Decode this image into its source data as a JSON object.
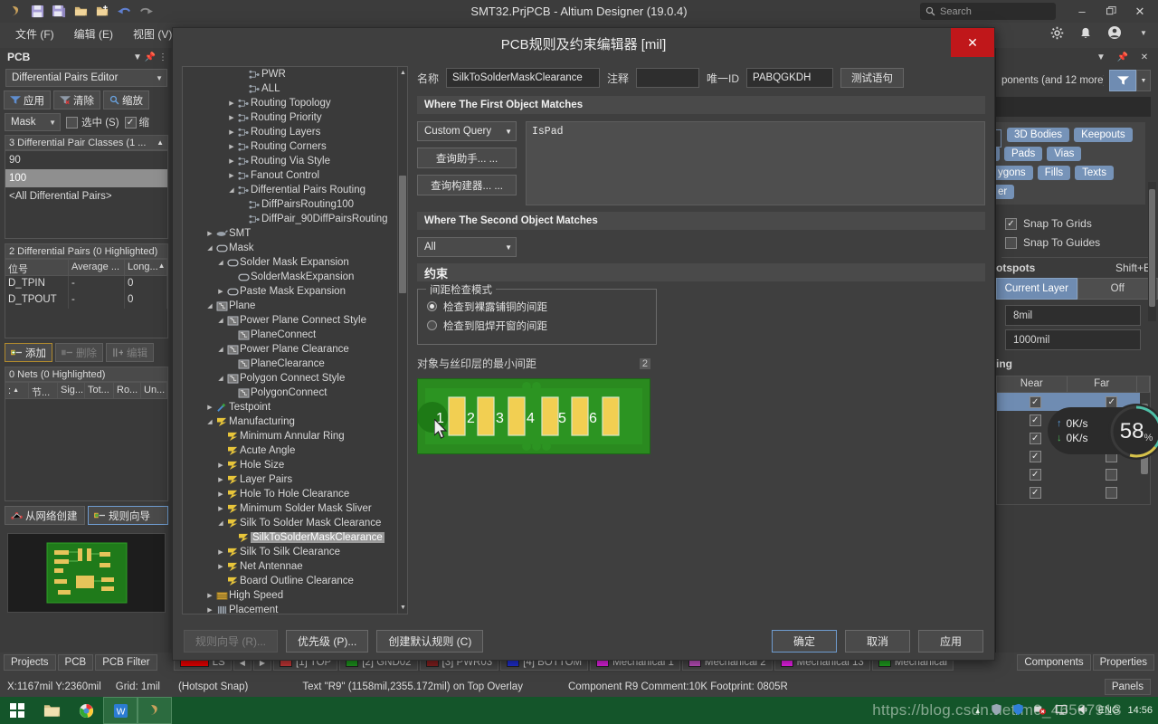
{
  "titlebar": {
    "title": "SMT32.PrjPCB - Altium Designer (19.0.4)",
    "search_placeholder": "Search",
    "minimize": "–",
    "maximize": "❐",
    "close": "✕"
  },
  "menubar": {
    "items": [
      {
        "label": "文件 (F)"
      },
      {
        "label": "编辑 (E)"
      },
      {
        "label": "视图 (V)"
      }
    ]
  },
  "left_panel": {
    "title": "PCB",
    "editor_select": "Differential Pairs Editor",
    "buttons": [
      {
        "label": "应用"
      },
      {
        "label": "清除"
      },
      {
        "label": "缩放"
      }
    ],
    "mask_select": "Mask",
    "select_checkbox_label": "选中 (S)",
    "zoom_checkbox_label": "缩",
    "classes_header": "3 Differential Pair Classes (1 ...",
    "classes": [
      {
        "label": "90",
        "selected": false
      },
      {
        "label": "100",
        "selected": true
      },
      {
        "label": "<All Differential Pairs>",
        "selected": false
      }
    ],
    "pairs_header": "2 Differential Pairs (0 Highlighted)",
    "pairs_columns": [
      "位号",
      "Average ...",
      "Long..."
    ],
    "pairs_rows": [
      [
        "D_TPIN",
        "-",
        "0"
      ],
      [
        "D_TPOUT",
        "-",
        "0"
      ]
    ],
    "action_buttons": [
      {
        "label": "添加",
        "enabled": true
      },
      {
        "label": "删除",
        "enabled": false
      },
      {
        "label": "编辑",
        "enabled": false
      }
    ],
    "nets_header": "0 Nets (0 Highlighted)",
    "nets_columns": [
      ":",
      "节...",
      "Sig...",
      "Tot...",
      "Ro...",
      "Un..."
    ],
    "footer_buttons": [
      {
        "label": "从网络创建"
      },
      {
        "label": "规则向导"
      }
    ]
  },
  "right_panel": {
    "objects_summary": "ponents (and 12 more)",
    "chips": [
      {
        "label": "3D Bodies"
      },
      {
        "label": "Keepouts"
      },
      {
        "label": "Pads"
      },
      {
        "label": "Vias"
      },
      {
        "label": "ygons"
      },
      {
        "label": "Fills"
      },
      {
        "label": "Texts"
      },
      {
        "label": "er"
      }
    ],
    "snap_to_grids": "Snap To Grids",
    "snap_to_guides": "Snap To Guides",
    "hotspots_label": "otspots",
    "hotspots_shortcut": "Shift+E",
    "layer_toggle": {
      "on": "Current Layer",
      "off": "Off"
    },
    "range_near": "8mil",
    "range_far": "1000mil",
    "section_label": "ing",
    "nearfar_columns": [
      "Near",
      "Far"
    ],
    "nearfar_rows": [
      {
        "near": true,
        "far": true,
        "selected": true
      },
      {
        "near": true,
        "far": true,
        "selected": false
      },
      {
        "near": true,
        "far": true,
        "selected": false
      },
      {
        "near": true,
        "far": false,
        "selected": false
      },
      {
        "near": true,
        "far": false,
        "selected": false
      },
      {
        "near": true,
        "far": false,
        "selected": false
      },
      {
        "near": true,
        "far": false,
        "selected": false
      }
    ]
  },
  "network_widget": {
    "upload": "0K/s",
    "download": "0K/s",
    "percent": "58",
    "percent_unit": "%"
  },
  "dialog": {
    "title": "PCB规则及约束编辑器 [mil]",
    "close": "✕",
    "name_label": "名称",
    "name_value": "SilkToSolderMaskClearance",
    "comment_label": "注释",
    "comment_value": "",
    "uid_label": "唯一ID",
    "uid_value": "PABQGKDH",
    "test_button": "测试语句",
    "first_object_header": "Where The First Object Matches",
    "query_kind": "Custom Query",
    "query_helper_button": "查询助手... ...",
    "query_builder_button": "查询构建器... ...",
    "query_text": "IsPad",
    "second_object_header": "Where The Second Object Matches",
    "second_object_scope": "All",
    "constraints_header": "约束",
    "check_mode_legend": "间距检查模式",
    "check_mode_options": [
      {
        "label": "检查到裸露铺铜的间距",
        "selected": true
      },
      {
        "label": "检查到阻焊开窗的间距",
        "selected": false
      }
    ],
    "clearance_label": "对象与丝印层的最小间距",
    "clearance_value": "2",
    "pad_numbers": [
      "1",
      "2",
      "3",
      "4",
      "5",
      "6"
    ],
    "footer": {
      "wizard": "规则向导 (R)...",
      "priority": "优先级 (P)...",
      "defaults": "创建默认规则 (C)",
      "ok": "确定",
      "cancel": "取消",
      "apply": "应用"
    },
    "tree": [
      {
        "label": "PWR",
        "indent": 5,
        "arrow": "",
        "icon": "net",
        "selected": false
      },
      {
        "label": "ALL",
        "indent": 5,
        "arrow": "",
        "icon": "net",
        "selected": false
      },
      {
        "label": "Routing Topology",
        "indent": 4,
        "arrow": "collapsed",
        "icon": "net",
        "selected": false
      },
      {
        "label": "Routing Priority",
        "indent": 4,
        "arrow": "collapsed",
        "icon": "net",
        "selected": false
      },
      {
        "label": "Routing Layers",
        "indent": 4,
        "arrow": "collapsed",
        "icon": "net",
        "selected": false
      },
      {
        "label": "Routing Corners",
        "indent": 4,
        "arrow": "collapsed",
        "icon": "net",
        "selected": false
      },
      {
        "label": "Routing Via Style",
        "indent": 4,
        "arrow": "collapsed",
        "icon": "net",
        "selected": false
      },
      {
        "label": "Fanout Control",
        "indent": 4,
        "arrow": "collapsed",
        "icon": "net",
        "selected": false
      },
      {
        "label": "Differential Pairs Routing",
        "indent": 4,
        "arrow": "expanded",
        "icon": "net",
        "selected": false
      },
      {
        "label": "DiffPairsRouting100",
        "indent": 5,
        "arrow": "",
        "icon": "net",
        "selected": false
      },
      {
        "label": "DiffPair_90DiffPairsRouting",
        "indent": 5,
        "arrow": "",
        "icon": "net",
        "selected": false
      },
      {
        "label": "SMT",
        "indent": 2,
        "arrow": "collapsed",
        "icon": "smt",
        "selected": false
      },
      {
        "label": "Mask",
        "indent": 2,
        "arrow": "expanded",
        "icon": "mask",
        "selected": false
      },
      {
        "label": "Solder Mask Expansion",
        "indent": 3,
        "arrow": "expanded",
        "icon": "mask",
        "selected": false
      },
      {
        "label": "SolderMaskExpansion",
        "indent": 4,
        "arrow": "",
        "icon": "mask",
        "selected": false
      },
      {
        "label": "Paste Mask Expansion",
        "indent": 3,
        "arrow": "collapsed",
        "icon": "mask",
        "selected": false
      },
      {
        "label": "Plane",
        "indent": 2,
        "arrow": "expanded",
        "icon": "plane",
        "selected": false
      },
      {
        "label": "Power Plane Connect Style",
        "indent": 3,
        "arrow": "expanded",
        "icon": "plane",
        "selected": false
      },
      {
        "label": "PlaneConnect",
        "indent": 4,
        "arrow": "",
        "icon": "plane",
        "selected": false
      },
      {
        "label": "Power Plane Clearance",
        "indent": 3,
        "arrow": "expanded",
        "icon": "plane",
        "selected": false
      },
      {
        "label": "PlaneClearance",
        "indent": 4,
        "arrow": "",
        "icon": "plane",
        "selected": false
      },
      {
        "label": "Polygon Connect Style",
        "indent": 3,
        "arrow": "expanded",
        "icon": "plane",
        "selected": false
      },
      {
        "label": "PolygonConnect",
        "indent": 4,
        "arrow": "",
        "icon": "plane",
        "selected": false
      },
      {
        "label": "Testpoint",
        "indent": 2,
        "arrow": "collapsed",
        "icon": "testpoint",
        "selected": false
      },
      {
        "label": "Manufacturing",
        "indent": 2,
        "arrow": "expanded",
        "icon": "mfg",
        "selected": false
      },
      {
        "label": "Minimum Annular Ring",
        "indent": 3,
        "arrow": "",
        "icon": "mfg",
        "selected": false
      },
      {
        "label": "Acute Angle",
        "indent": 3,
        "arrow": "",
        "icon": "mfg",
        "selected": false
      },
      {
        "label": "Hole Size",
        "indent": 3,
        "arrow": "collapsed",
        "icon": "mfg",
        "selected": false
      },
      {
        "label": "Layer Pairs",
        "indent": 3,
        "arrow": "collapsed",
        "icon": "mfg",
        "selected": false
      },
      {
        "label": "Hole To Hole Clearance",
        "indent": 3,
        "arrow": "collapsed",
        "icon": "mfg",
        "selected": false
      },
      {
        "label": "Minimum Solder Mask Sliver",
        "indent": 3,
        "arrow": "collapsed",
        "icon": "mfg",
        "selected": false
      },
      {
        "label": "Silk To Solder Mask Clearance",
        "indent": 3,
        "arrow": "expanded",
        "icon": "mfg",
        "selected": false
      },
      {
        "label": "SilkToSolderMaskClearance",
        "indent": 4,
        "arrow": "",
        "icon": "mfg",
        "selected": true
      },
      {
        "label": "Silk To Silk Clearance",
        "indent": 3,
        "arrow": "collapsed",
        "icon": "mfg",
        "selected": false
      },
      {
        "label": "Net Antennae",
        "indent": 3,
        "arrow": "collapsed",
        "icon": "mfg",
        "selected": false
      },
      {
        "label": "Board Outline Clearance",
        "indent": 3,
        "arrow": "",
        "icon": "mfg",
        "selected": false
      },
      {
        "label": "High Speed",
        "indent": 2,
        "arrow": "collapsed",
        "icon": "highspeed",
        "selected": false
      },
      {
        "label": "Placement",
        "indent": 2,
        "arrow": "collapsed",
        "icon": "placement",
        "selected": false
      }
    ]
  },
  "bottom_tabs": [
    {
      "label": "Projects"
    },
    {
      "label": "PCB"
    },
    {
      "label": "PCB Filter"
    }
  ],
  "layer_tabs": [
    {
      "label": "LS",
      "color": "#ff0000"
    },
    {
      "label": "[1] TOP",
      "color": "#d03a3a"
    },
    {
      "label": "[2] GND02",
      "color": "#1f9e1f"
    },
    {
      "label": "[3] PWR03",
      "color": "#8b2020"
    },
    {
      "label": "[4] BOTTOM",
      "color": "#2030dd"
    },
    {
      "label": "Mechanical 1",
      "color": "#ee22ee"
    },
    {
      "label": "Mechanical 2",
      "color": "#cc55cc"
    },
    {
      "label": "Mechanical 13",
      "color": "#ff22ff"
    },
    {
      "label": "Mechanical",
      "color": "#22aa22"
    }
  ],
  "right_bottom_tabs": [
    {
      "label": "Components"
    },
    {
      "label": "Properties"
    }
  ],
  "statusbar": {
    "coords": "X:1167mil Y:2360mil",
    "grid": "Grid: 1mil",
    "snap": "(Hotspot Snap)",
    "object": "Text \"R9\" (1158mil,2355.172mil) on Top Overlay",
    "component": "Component R9 Comment:10K Footprint: 0805R",
    "panels": "Panels"
  },
  "taskbar": {
    "clock": "14:56",
    "language": "ENG",
    "watermark": "https://blog.csdn.net/m0_46507918"
  }
}
